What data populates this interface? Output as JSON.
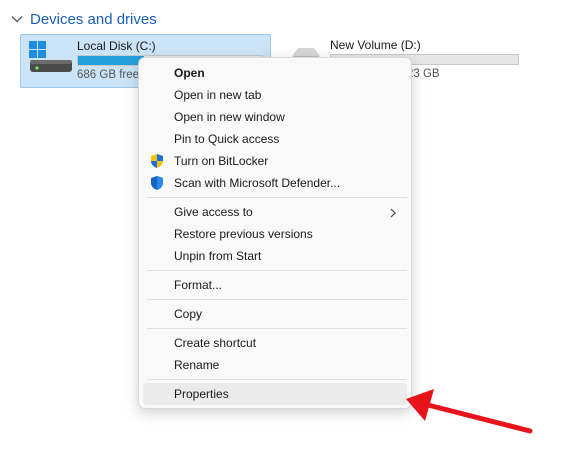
{
  "section": {
    "title": "Devices and drives"
  },
  "drives": [
    {
      "name": "Local Disk (C:)",
      "free_text": "686 GB free",
      "used_fraction": 0.36,
      "selected": true
    },
    {
      "name": "New Volume (D:)",
      "free_text": "23 GB",
      "used_fraction": 0.0,
      "selected": false
    }
  ],
  "menu": {
    "groups": [
      [
        {
          "label": "Open",
          "bold": true
        },
        {
          "label": "Open in new tab"
        },
        {
          "label": "Open in new window"
        },
        {
          "label": "Pin to Quick access"
        },
        {
          "label": "Turn on BitLocker",
          "icon": "shield-uac-icon"
        },
        {
          "label": "Scan with Microsoft Defender...",
          "icon": "defender-shield-icon"
        }
      ],
      [
        {
          "label": "Give access to",
          "submenu": true
        },
        {
          "label": "Restore previous versions"
        },
        {
          "label": "Unpin from Start"
        }
      ],
      [
        {
          "label": "Format..."
        }
      ],
      [
        {
          "label": "Copy"
        }
      ],
      [
        {
          "label": "Create shortcut"
        },
        {
          "label": "Rename"
        }
      ],
      [
        {
          "label": "Properties",
          "highlighted": true
        }
      ]
    ]
  },
  "colors": {
    "accent": "#1a5fb4",
    "selection_bg": "#cce4f7",
    "bar_fill": "#26a0da",
    "annotation_arrow": "#e8121a"
  }
}
